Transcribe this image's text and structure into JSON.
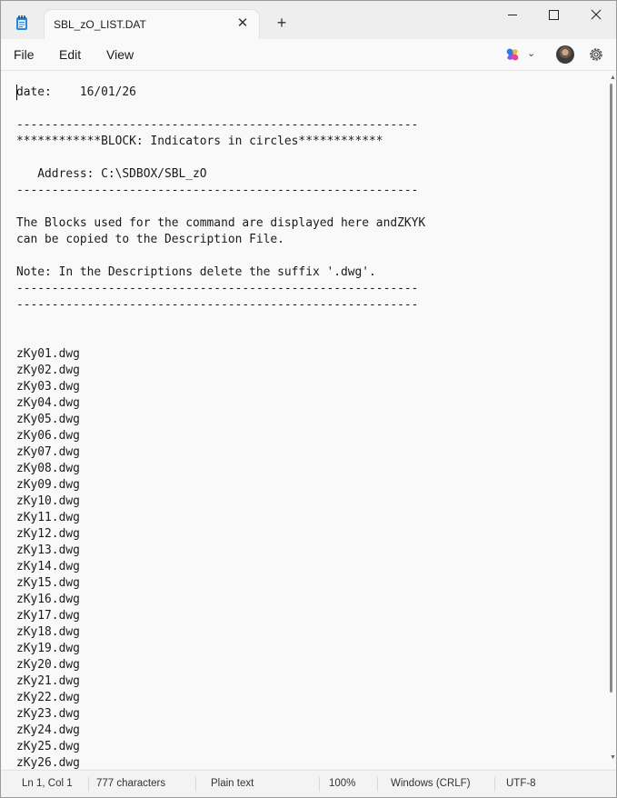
{
  "window": {
    "tab_title": "SBL_zO_LIST.DAT",
    "new_tab_symbol": "+"
  },
  "menu": {
    "file": "File",
    "edit": "Edit",
    "view": "View"
  },
  "icons": {
    "app": "notepad-icon",
    "copilot": "copilot-icon",
    "settings": "gear-icon"
  },
  "editor": {
    "lines": [
      "date:    16/01/26",
      "",
      "---------------------------------------------------------",
      "************BLOCK: Indicators in circles************",
      "",
      "   Address: C:\\SDBOX/SBL_zO",
      "---------------------------------------------------------",
      "",
      "The Blocks used for the command are displayed here andZKYK",
      "can be copied to the Description File.",
      "",
      "Note: In the Descriptions delete the suffix '.dwg'.",
      "---------------------------------------------------------",
      "---------------------------------------------------------",
      "",
      "",
      "zKy01.dwg",
      "zKy02.dwg",
      "zKy03.dwg",
      "zKy04.dwg",
      "zKy05.dwg",
      "zKy06.dwg",
      "zKy07.dwg",
      "zKy08.dwg",
      "zKy09.dwg",
      "zKy10.dwg",
      "zKy11.dwg",
      "zKy12.dwg",
      "zKy13.dwg",
      "zKy14.dwg",
      "zKy15.dwg",
      "zKy16.dwg",
      "zKy17.dwg",
      "zKy18.dwg",
      "zKy19.dwg",
      "zKy20.dwg",
      "zKy21.dwg",
      "zKy22.dwg",
      "zKy23.dwg",
      "zKy24.dwg",
      "zKy25.dwg",
      "zKy26.dwg"
    ]
  },
  "status": {
    "position": "Ln 1, Col 1",
    "characters": "777 characters",
    "file_type": "Plain text",
    "zoom": "100%",
    "line_ending": "Windows (CRLF)",
    "encoding": "UTF-8"
  }
}
